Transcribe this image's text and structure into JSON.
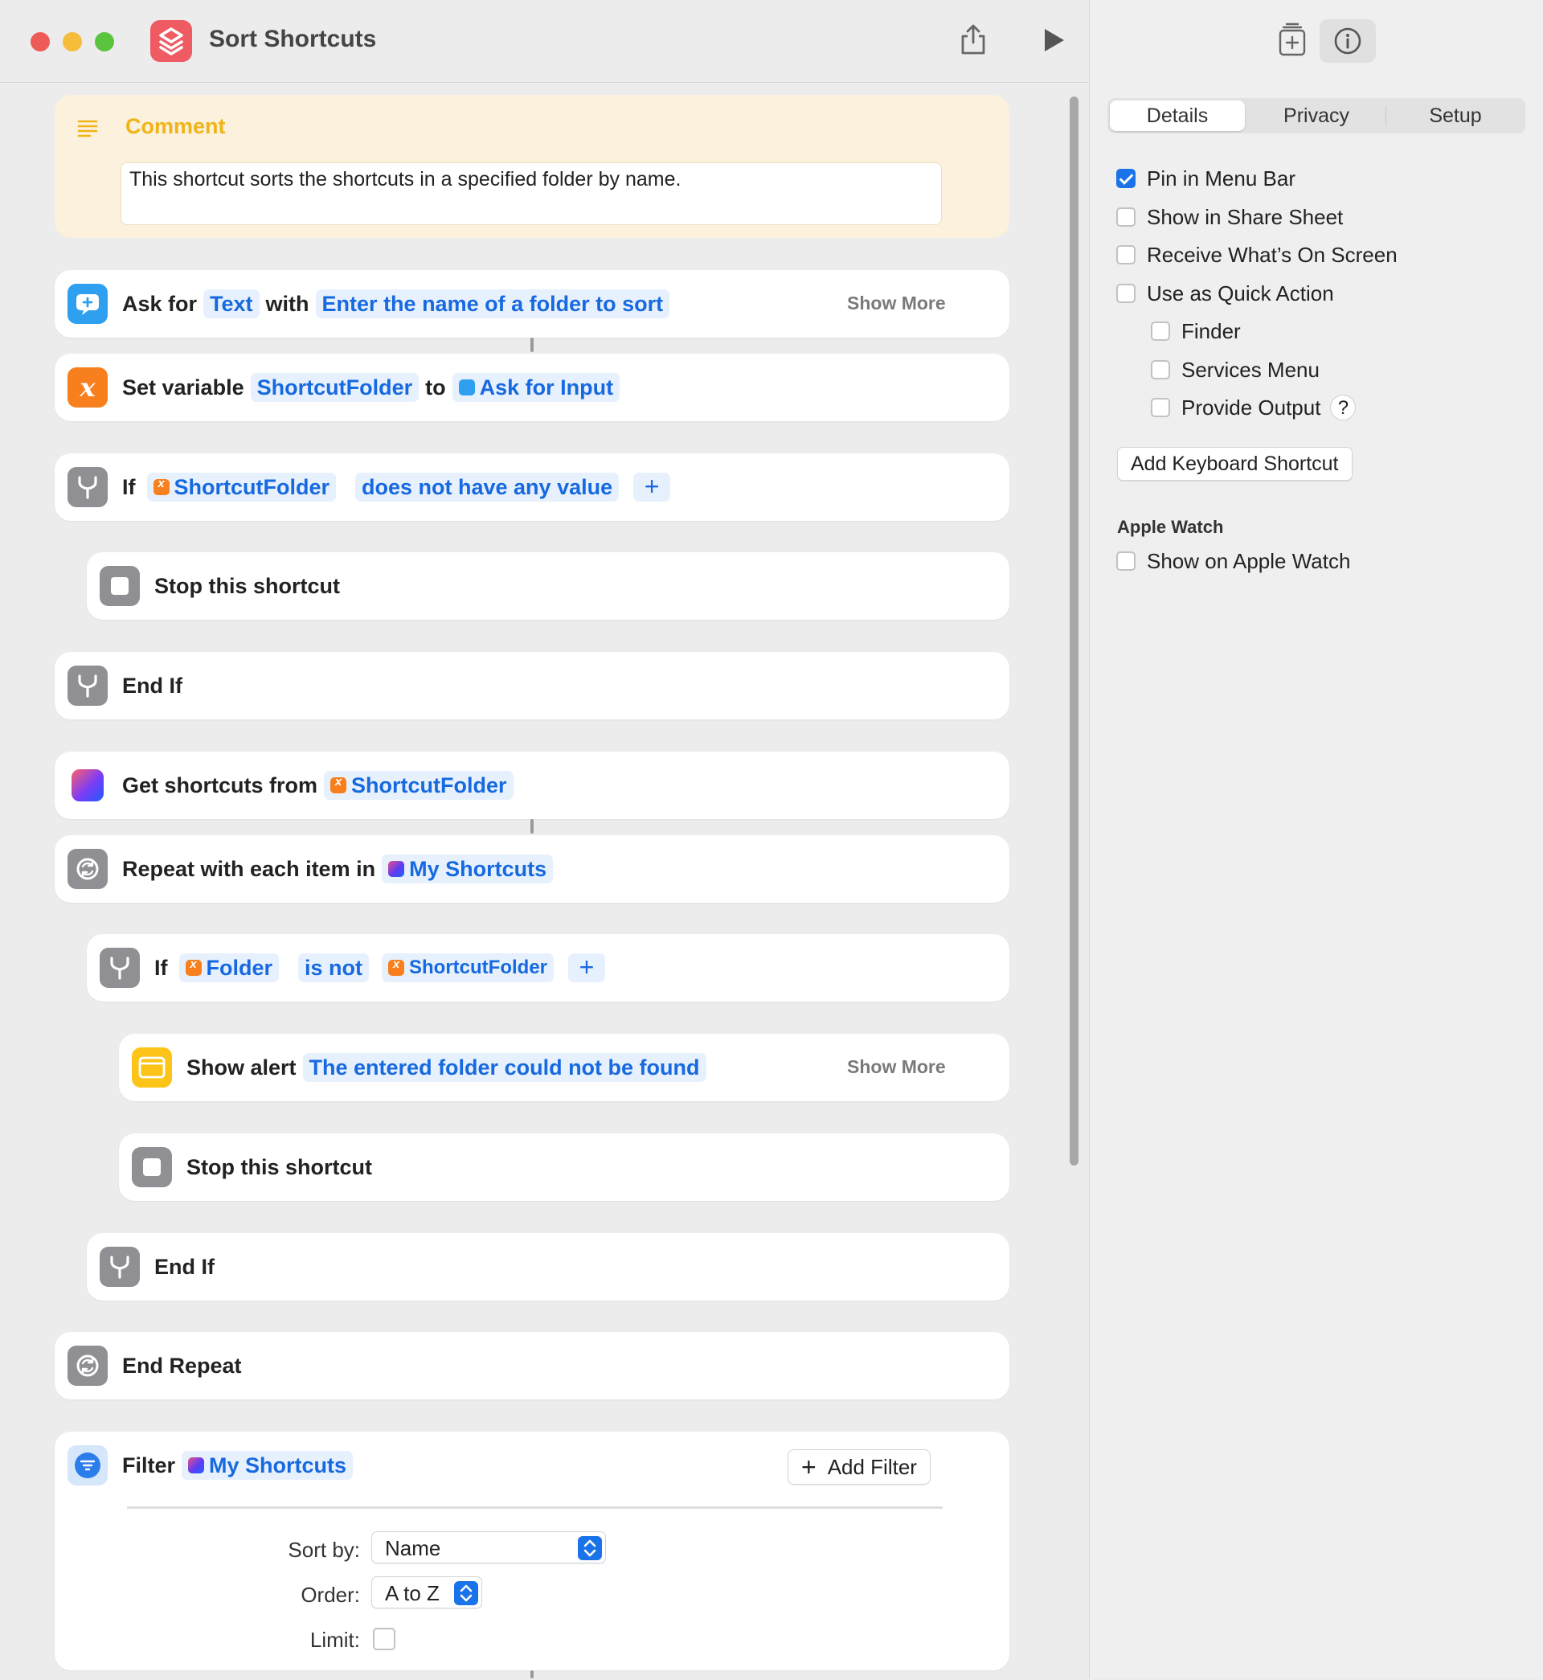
{
  "window": {
    "title": "Sort Shortcuts"
  },
  "colors": {
    "accent": "#1a73e8",
    "token_text": "#1769e0",
    "comment": "#f0b418"
  },
  "comment": {
    "title": "Comment",
    "text": "This shortcut sorts the shortcuts in a specified folder by name."
  },
  "actions": {
    "ask": {
      "label1": "Ask for",
      "tok1": "Text",
      "label2": "with",
      "tok2": "Enter the name of a folder to sort",
      "more": "Show More"
    },
    "setvar": {
      "label1": "Set variable",
      "tok1": "ShortcutFolder",
      "label2": "to",
      "tok2": "Ask for Input"
    },
    "if1": {
      "label": "If",
      "tok1": "ShortcutFolder",
      "tok2": "does not have any value",
      "plus": "+"
    },
    "stop1": {
      "label": "Stop this shortcut"
    },
    "endif1": {
      "label": "End If"
    },
    "getshortcuts": {
      "label": "Get shortcuts from",
      "tok1": "ShortcutFolder"
    },
    "repeat": {
      "label": "Repeat with each item in",
      "tok1": "My Shortcuts"
    },
    "if2": {
      "label": "If",
      "tok1": "Folder",
      "tok2": "is not",
      "tok3": "ShortcutFolder",
      "plus": "+"
    },
    "alert": {
      "label": "Show alert",
      "tok1": "The entered folder could not be found",
      "more": "Show More"
    },
    "stop2": {
      "label": "Stop this shortcut"
    },
    "endif2": {
      "label": "End If"
    },
    "endrepeat": {
      "label": "End Repeat"
    },
    "filter": {
      "label": "Filter",
      "tok1": "My Shortcuts",
      "add_filter": "Add Filter",
      "add_icon": "+",
      "sort_label": "Sort by:",
      "sort_value": "Name",
      "order_label": "Order:",
      "order_value": "A to Z",
      "limit_label": "Limit:"
    }
  },
  "sidebar": {
    "tabs": [
      "Details",
      "Privacy",
      "Setup"
    ],
    "selected_tab": "Details",
    "options": [
      {
        "label": "Pin in Menu Bar",
        "checked": true
      },
      {
        "label": "Show in Share Sheet",
        "checked": false
      },
      {
        "label": "Receive What’s On Screen",
        "checked": false
      },
      {
        "label": "Use as Quick Action",
        "checked": false
      },
      {
        "label": "Finder",
        "checked": false
      },
      {
        "label": "Services Menu",
        "checked": false
      },
      {
        "label": "Provide Output",
        "checked": false
      }
    ],
    "help": "?",
    "add_keyboard_shortcut": "Add Keyboard Shortcut",
    "apple_watch_title": "Apple Watch",
    "apple_watch_option": {
      "label": "Show on Apple Watch",
      "checked": false
    }
  },
  "icons": {
    "share": "share-icon",
    "run": "play-icon",
    "library": "add-to-library-icon",
    "info": "info-icon",
    "comment": "comment-lines-icon",
    "ask": "ask-input-icon",
    "variable": "variable-icon",
    "if": "branch-icon",
    "stop": "stop-icon",
    "shortcuts": "shortcuts-icon",
    "repeat": "repeat-icon",
    "alert": "alert-icon",
    "filter": "filter-icon"
  }
}
